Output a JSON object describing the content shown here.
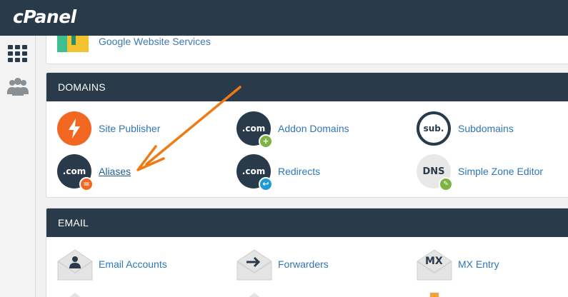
{
  "app": {
    "logo": "cPanel"
  },
  "sidebar": {
    "items": [
      {
        "icon": "grid-icon"
      },
      {
        "icon": "users-icon"
      }
    ]
  },
  "partial_item": {
    "label": "Google Website Services",
    "icon": "google-website-services-icon"
  },
  "sections": {
    "domains": {
      "title": "DOMAINS",
      "items": [
        {
          "label": "Site Publisher",
          "icon": "lightning-bolt-icon"
        },
        {
          "label": "Addon Domains",
          "icon_text": ".com",
          "badge": "+"
        },
        {
          "label": "Subdomains",
          "icon_text": "sub."
        },
        {
          "label": "Aliases",
          "icon_text": ".com",
          "badge": "="
        },
        {
          "label": "Redirects",
          "icon_text": ".com",
          "badge": "↩"
        },
        {
          "label": "Simple Zone Editor",
          "icon_text": "DNS",
          "badge": "✎"
        }
      ]
    },
    "email": {
      "title": "EMAIL",
      "items": [
        {
          "label": "Email Accounts",
          "icon": "envelope-person-icon"
        },
        {
          "label": "Forwarders",
          "icon": "envelope-arrow-icon"
        },
        {
          "label": "MX Entry",
          "icon_text": "MX"
        }
      ]
    }
  },
  "colors": {
    "header": "#293a4a",
    "link": "#2f76b7",
    "accent_orange": "#f26722",
    "dark_icon": "#293a4a",
    "green": "#7cb342",
    "blue": "#1e9ad6"
  }
}
